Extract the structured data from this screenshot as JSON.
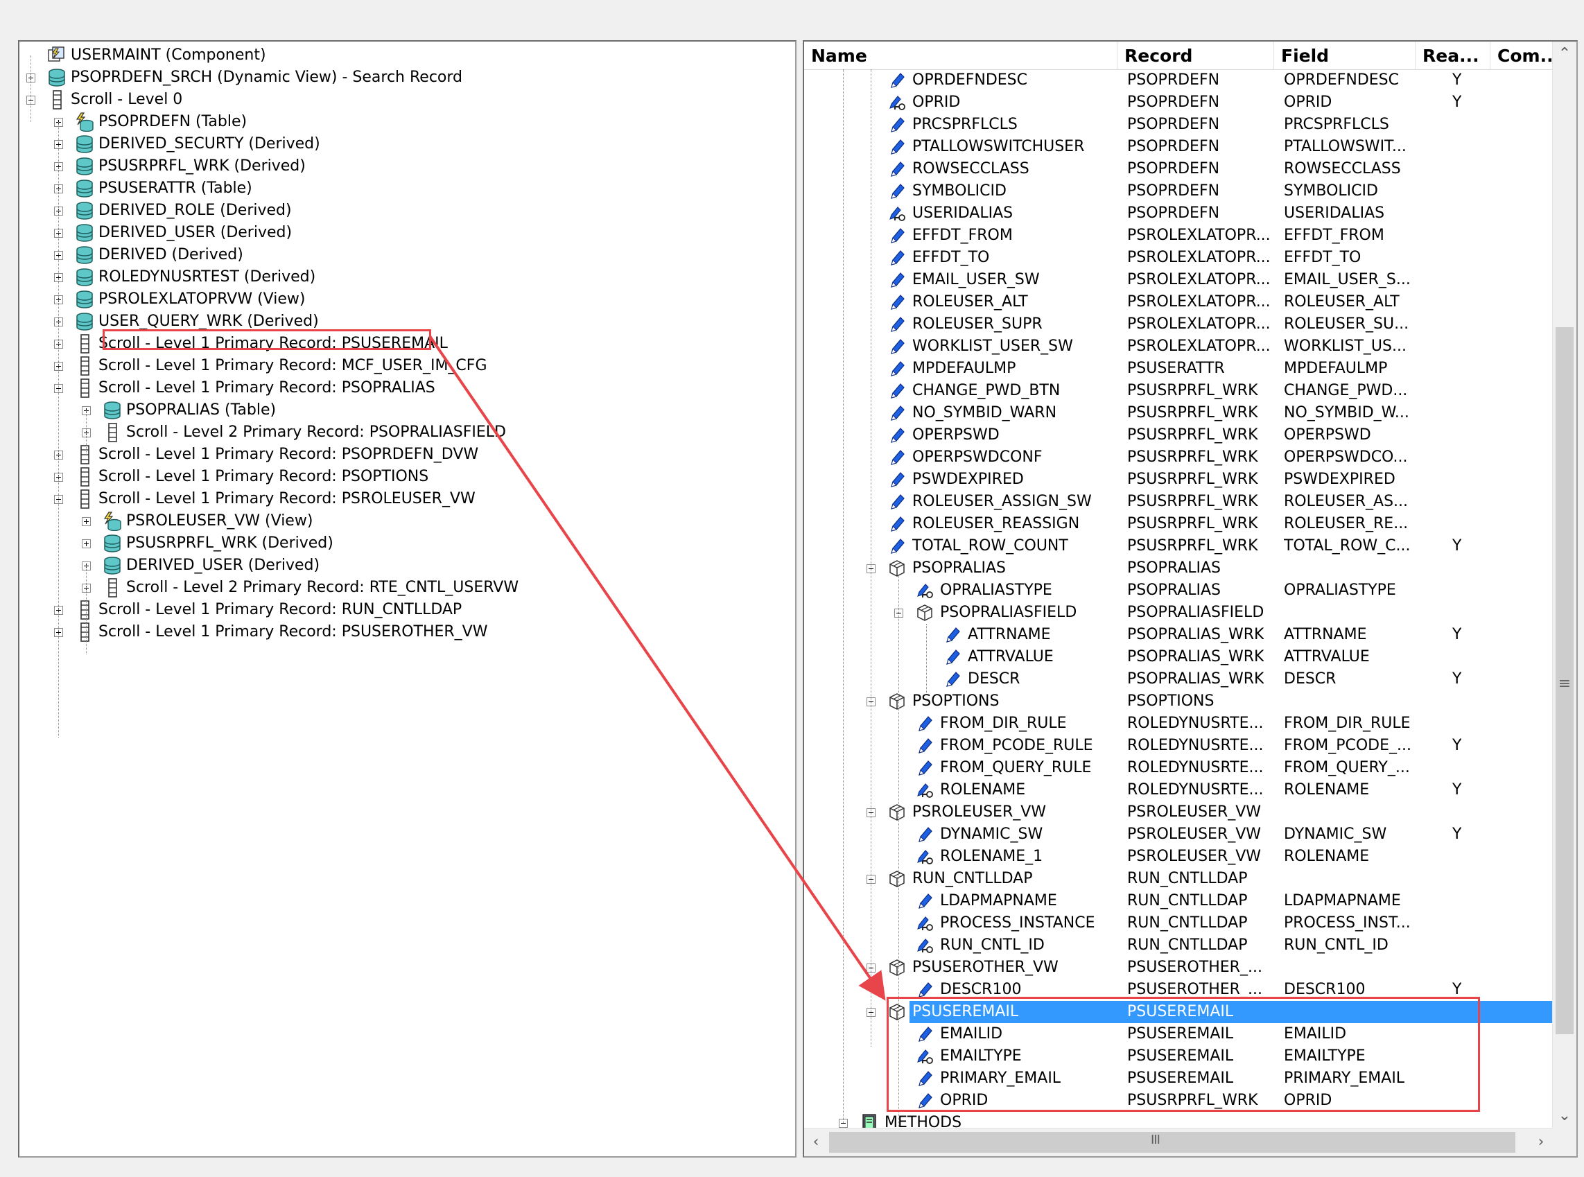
{
  "left_tree": [
    {
      "indent": 0,
      "icon": "component-icon",
      "label": "USERMAINT (Component)",
      "expander": "none"
    },
    {
      "indent": 0,
      "icon": "record-db-icon",
      "label": "PSOPRDEFN_SRCH (Dynamic View) - Search Record",
      "expander": "plus"
    },
    {
      "indent": 0,
      "icon": "scroll-icon",
      "label": "Scroll - Level 0",
      "expander": "minus"
    },
    {
      "indent": 1,
      "icon": "table-view-icon",
      "label": "PSOPRDEFN (Table)",
      "expander": "plus"
    },
    {
      "indent": 1,
      "icon": "record-db-icon",
      "label": "DERIVED_SECURTY (Derived)",
      "expander": "plus"
    },
    {
      "indent": 1,
      "icon": "record-db-icon",
      "label": "PSUSRPRFL_WRK (Derived)",
      "expander": "plus"
    },
    {
      "indent": 1,
      "icon": "record-db-icon",
      "label": "PSUSERATTR (Table)",
      "expander": "plus"
    },
    {
      "indent": 1,
      "icon": "record-db-icon",
      "label": "DERIVED_ROLE (Derived)",
      "expander": "plus"
    },
    {
      "indent": 1,
      "icon": "record-db-icon",
      "label": "DERIVED_USER (Derived)",
      "expander": "plus"
    },
    {
      "indent": 1,
      "icon": "record-db-icon",
      "label": "DERIVED (Derived)",
      "expander": "plus"
    },
    {
      "indent": 1,
      "icon": "record-db-icon",
      "label": "ROLEDYNUSRTEST (Derived)",
      "expander": "plus"
    },
    {
      "indent": 1,
      "icon": "record-db-icon",
      "label": "PSROLEXLATOPRVW (View)",
      "expander": "plus"
    },
    {
      "indent": 1,
      "icon": "record-db-icon",
      "label": "USER_QUERY_WRK (Derived)",
      "expander": "plus"
    },
    {
      "indent": 1,
      "icon": "scroll-icon",
      "label": "Scroll - Level 1  Primary Record: PSUSEREMAIL",
      "expander": "plus"
    },
    {
      "indent": 1,
      "icon": "scroll-icon",
      "label": "Scroll - Level 1  Primary Record: MCF_USER_IM_CFG",
      "expander": "plus"
    },
    {
      "indent": 1,
      "icon": "scroll-icon",
      "label": "Scroll - Level 1  Primary Record: PSOPRALIAS",
      "expander": "minus"
    },
    {
      "indent": 2,
      "icon": "record-db-icon",
      "label": "PSOPRALIAS (Table)",
      "expander": "plus"
    },
    {
      "indent": 2,
      "icon": "scroll-icon",
      "label": "Scroll - Level 2  Primary Record: PSOPRALIASFIELD",
      "expander": "plus"
    },
    {
      "indent": 1,
      "icon": "scroll-icon",
      "label": "Scroll - Level 1  Primary Record: PSOPRDEFN_DVW",
      "expander": "plus"
    },
    {
      "indent": 1,
      "icon": "scroll-icon",
      "label": "Scroll - Level 1  Primary Record: PSOPTIONS",
      "expander": "plus"
    },
    {
      "indent": 1,
      "icon": "scroll-icon",
      "label": "Scroll - Level 1  Primary Record: PSROLEUSER_VW",
      "expander": "minus"
    },
    {
      "indent": 2,
      "icon": "table-view-icon",
      "label": "PSROLEUSER_VW (View)",
      "expander": "plus"
    },
    {
      "indent": 2,
      "icon": "record-db-icon",
      "label": "PSUSRPRFL_WRK (Derived)",
      "expander": "plus"
    },
    {
      "indent": 2,
      "icon": "record-db-icon",
      "label": "DERIVED_USER (Derived)",
      "expander": "plus"
    },
    {
      "indent": 2,
      "icon": "scroll-icon",
      "label": "Scroll - Level 2  Primary Record: RTE_CNTL_USERVW",
      "expander": "plus"
    },
    {
      "indent": 1,
      "icon": "scroll-icon",
      "label": "Scroll - Level 1  Primary Record: RUN_CNTLLDAP",
      "expander": "plus"
    },
    {
      "indent": 1,
      "icon": "scroll-icon",
      "label": "Scroll - Level 1  Primary Record: PSUSEROTHER_VW",
      "expander": "plus"
    }
  ],
  "grid_columns": [
    "Name",
    "Record",
    "Field",
    "Rea...",
    "Com.."
  ],
  "grid_rows": [
    {
      "lvl": 1,
      "icon": "field-icon",
      "name": "OPRDEFNDESC",
      "record": "PSOPRDEFN",
      "field": "OPRDEFNDESC",
      "rea": "Y"
    },
    {
      "lvl": 1,
      "icon": "key-field-icon",
      "name": "OPRID",
      "record": "PSOPRDEFN",
      "field": "OPRID",
      "rea": "Y"
    },
    {
      "lvl": 1,
      "icon": "field-icon",
      "name": "PRCSPRFLCLS",
      "record": "PSOPRDEFN",
      "field": "PRCSPRFLCLS",
      "rea": ""
    },
    {
      "lvl": 1,
      "icon": "field-icon",
      "name": "PTALLOWSWITCHUSER",
      "record": "PSOPRDEFN",
      "field": "PTALLOWSWIT...",
      "rea": ""
    },
    {
      "lvl": 1,
      "icon": "field-icon",
      "name": "ROWSECCLASS",
      "record": "PSOPRDEFN",
      "field": "ROWSECCLASS",
      "rea": ""
    },
    {
      "lvl": 1,
      "icon": "field-icon",
      "name": "SYMBOLICID",
      "record": "PSOPRDEFN",
      "field": "SYMBOLICID",
      "rea": ""
    },
    {
      "lvl": 1,
      "icon": "key-field-icon",
      "name": "USERIDALIAS",
      "record": "PSOPRDEFN",
      "field": "USERIDALIAS",
      "rea": ""
    },
    {
      "lvl": 1,
      "icon": "field-icon",
      "name": "EFFDT_FROM",
      "record": "PSROLEXLATOPR...",
      "field": "EFFDT_FROM",
      "rea": ""
    },
    {
      "lvl": 1,
      "icon": "field-icon",
      "name": "EFFDT_TO",
      "record": "PSROLEXLATOPR...",
      "field": "EFFDT_TO",
      "rea": ""
    },
    {
      "lvl": 1,
      "icon": "field-icon",
      "name": "EMAIL_USER_SW",
      "record": "PSROLEXLATOPR...",
      "field": "EMAIL_USER_S...",
      "rea": ""
    },
    {
      "lvl": 1,
      "icon": "field-icon",
      "name": "ROLEUSER_ALT",
      "record": "PSROLEXLATOPR...",
      "field": "ROLEUSER_ALT",
      "rea": ""
    },
    {
      "lvl": 1,
      "icon": "field-icon",
      "name": "ROLEUSER_SUPR",
      "record": "PSROLEXLATOPR...",
      "field": "ROLEUSER_SU...",
      "rea": ""
    },
    {
      "lvl": 1,
      "icon": "field-icon",
      "name": "WORKLIST_USER_SW",
      "record": "PSROLEXLATOPR...",
      "field": "WORKLIST_US...",
      "rea": ""
    },
    {
      "lvl": 1,
      "icon": "field-icon",
      "name": "MPDEFAULMP",
      "record": "PSUSERATTR",
      "field": "MPDEFAULMP",
      "rea": ""
    },
    {
      "lvl": 1,
      "icon": "field-icon",
      "name": "CHANGE_PWD_BTN",
      "record": "PSUSRPRFL_WRK",
      "field": "CHANGE_PWD...",
      "rea": ""
    },
    {
      "lvl": 1,
      "icon": "field-icon",
      "name": "NO_SYMBID_WARN",
      "record": "PSUSRPRFL_WRK",
      "field": "NO_SYMBID_W...",
      "rea": ""
    },
    {
      "lvl": 1,
      "icon": "field-icon",
      "name": "OPERPSWD",
      "record": "PSUSRPRFL_WRK",
      "field": "OPERPSWD",
      "rea": ""
    },
    {
      "lvl": 1,
      "icon": "field-icon",
      "name": "OPERPSWDCONF",
      "record": "PSUSRPRFL_WRK",
      "field": "OPERPSWDCO...",
      "rea": ""
    },
    {
      "lvl": 1,
      "icon": "field-icon",
      "name": "PSWDEXPIRED",
      "record": "PSUSRPRFL_WRK",
      "field": "PSWDEXPIRED",
      "rea": ""
    },
    {
      "lvl": 1,
      "icon": "field-icon",
      "name": "ROLEUSER_ASSIGN_SW",
      "record": "PSUSRPRFL_WRK",
      "field": "ROLEUSER_AS...",
      "rea": ""
    },
    {
      "lvl": 1,
      "icon": "field-icon",
      "name": "ROLEUSER_REASSIGN",
      "record": "PSUSRPRFL_WRK",
      "field": "ROLEUSER_RE...",
      "rea": ""
    },
    {
      "lvl": 1,
      "icon": "field-icon",
      "name": "TOTAL_ROW_COUNT",
      "record": "PSUSRPRFL_WRK",
      "field": "TOTAL_ROW_C...",
      "rea": "Y"
    },
    {
      "lvl": 1,
      "icon": "record-box-icon",
      "name": "PSOPRALIAS",
      "record": "PSOPRALIAS",
      "field": "",
      "rea": "",
      "exp": "minus"
    },
    {
      "lvl": 2,
      "icon": "key-field-icon",
      "name": "OPRALIASTYPE",
      "record": "PSOPRALIAS",
      "field": "OPRALIASTYPE",
      "rea": ""
    },
    {
      "lvl": 2,
      "icon": "record-box-icon",
      "name": "PSOPRALIASFIELD",
      "record": "PSOPRALIASFIELD",
      "field": "",
      "rea": "",
      "exp": "minus"
    },
    {
      "lvl": 3,
      "icon": "field-icon",
      "name": "ATTRNAME",
      "record": "PSOPRALIAS_WRK",
      "field": "ATTRNAME",
      "rea": "Y"
    },
    {
      "lvl": 3,
      "icon": "field-icon",
      "name": "ATTRVALUE",
      "record": "PSOPRALIAS_WRK",
      "field": "ATTRVALUE",
      "rea": ""
    },
    {
      "lvl": 3,
      "icon": "field-icon",
      "name": "DESCR",
      "record": "PSOPRALIAS_WRK",
      "field": "DESCR",
      "rea": "Y"
    },
    {
      "lvl": 1,
      "icon": "record-box-icon",
      "name": "PSOPTIONS",
      "record": "PSOPTIONS",
      "field": "",
      "rea": "",
      "exp": "minus"
    },
    {
      "lvl": 2,
      "icon": "field-icon",
      "name": "FROM_DIR_RULE",
      "record": "ROLEDYNUSRTE...",
      "field": "FROM_DIR_RULE",
      "rea": ""
    },
    {
      "lvl": 2,
      "icon": "field-icon",
      "name": "FROM_PCODE_RULE",
      "record": "ROLEDYNUSRTE...",
      "field": "FROM_PCODE_...",
      "rea": "Y"
    },
    {
      "lvl": 2,
      "icon": "field-icon",
      "name": "FROM_QUERY_RULE",
      "record": "ROLEDYNUSRTE...",
      "field": "FROM_QUERY_...",
      "rea": ""
    },
    {
      "lvl": 2,
      "icon": "key-field-icon",
      "name": "ROLENAME",
      "record": "ROLEDYNUSRTE...",
      "field": "ROLENAME",
      "rea": "Y"
    },
    {
      "lvl": 1,
      "icon": "record-box-icon",
      "name": "PSROLEUSER_VW",
      "record": "PSROLEUSER_VW",
      "field": "",
      "rea": "",
      "exp": "minus"
    },
    {
      "lvl": 2,
      "icon": "field-icon",
      "name": "DYNAMIC_SW",
      "record": "PSROLEUSER_VW",
      "field": "DYNAMIC_SW",
      "rea": "Y"
    },
    {
      "lvl": 2,
      "icon": "key-field-icon",
      "name": "ROLENAME_1",
      "record": "PSROLEUSER_VW",
      "field": "ROLENAME",
      "rea": ""
    },
    {
      "lvl": 1,
      "icon": "record-box-icon",
      "name": "RUN_CNTLLDAP",
      "record": "RUN_CNTLLDAP",
      "field": "",
      "rea": "",
      "exp": "minus"
    },
    {
      "lvl": 2,
      "icon": "field-icon",
      "name": "LDAPMAPNAME",
      "record": "RUN_CNTLLDAP",
      "field": "LDAPMAPNAME",
      "rea": ""
    },
    {
      "lvl": 2,
      "icon": "key-field-icon",
      "name": "PROCESS_INSTANCE",
      "record": "RUN_CNTLLDAP",
      "field": "PROCESS_INST...",
      "rea": ""
    },
    {
      "lvl": 2,
      "icon": "key-field-icon",
      "name": "RUN_CNTL_ID",
      "record": "RUN_CNTLLDAP",
      "field": "RUN_CNTL_ID",
      "rea": ""
    },
    {
      "lvl": 1,
      "icon": "record-box-icon",
      "name": "PSUSEROTHER_VW",
      "record": "PSUSEROTHER_...",
      "field": "",
      "rea": "",
      "exp": "minus"
    },
    {
      "lvl": 2,
      "icon": "field-icon",
      "name": "DESCR100",
      "record": "PSUSEROTHER_...",
      "field": "DESCR100",
      "rea": "Y"
    },
    {
      "lvl": 1,
      "icon": "record-box-icon",
      "name": "PSUSEREMAIL",
      "record": "PSUSEREMAIL",
      "field": "",
      "rea": "",
      "exp": "minus",
      "selected": true
    },
    {
      "lvl": 2,
      "icon": "field-icon",
      "name": "EMAILID",
      "record": "PSUSEREMAIL",
      "field": "EMAILID",
      "rea": ""
    },
    {
      "lvl": 2,
      "icon": "key-field-icon",
      "name": "EMAILTYPE",
      "record": "PSUSEREMAIL",
      "field": "EMAILTYPE",
      "rea": ""
    },
    {
      "lvl": 2,
      "icon": "field-icon",
      "name": "PRIMARY_EMAIL",
      "record": "PSUSEREMAIL",
      "field": "PRIMARY_EMAIL",
      "rea": ""
    },
    {
      "lvl": 2,
      "icon": "field-icon",
      "name": "OPRID",
      "record": "PSUSRPRFL_WRK",
      "field": "OPRID",
      "rea": ""
    },
    {
      "lvl": 0,
      "icon": "methods-icon",
      "name": "METHODS",
      "record": "",
      "field": "",
      "rea": "",
      "exp": "minus"
    }
  ],
  "colors": {
    "selection": "#3399ff",
    "highlight_box": "#e8454a",
    "db_icon_fill": "#5fc7c7",
    "field_icon": "#1d5fe0"
  },
  "scrollbar": {
    "grip_glyph": "≡",
    "hgrip_glyph": "III"
  }
}
